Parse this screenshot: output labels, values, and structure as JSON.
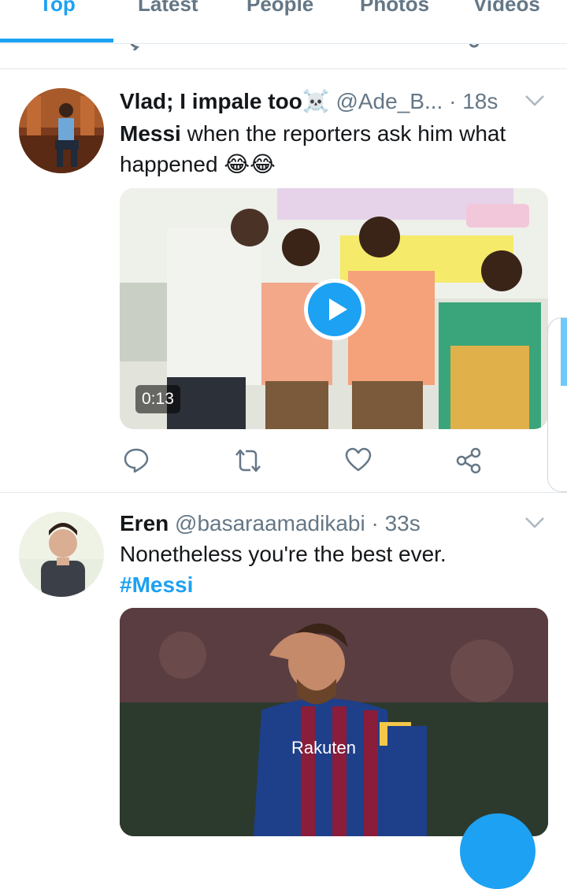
{
  "tabs": [
    {
      "label": "Top",
      "active": true
    },
    {
      "label": "Latest",
      "active": false
    },
    {
      "label": "People",
      "active": false
    },
    {
      "label": "Photos",
      "active": false
    },
    {
      "label": "Videos",
      "active": false
    }
  ],
  "tweets": [
    {
      "name": "Vlad; I impale too☠️",
      "handle": "@Ade_B...",
      "dot": "·",
      "time": "18s",
      "text_bold": "Messi",
      "text_rest": " when the reporters ask him what happened 😂😂",
      "media": {
        "type": "video",
        "duration": "0:13"
      }
    },
    {
      "name": "Eren",
      "handle": "@basaraamadikabi",
      "dot": "·",
      "time": "33s",
      "text": "Nonetheless you're the best ever.",
      "hashtag": "#Messi",
      "media": {
        "type": "photo",
        "jersey_text": "Rakuten"
      }
    }
  ],
  "icons": [
    "reply-icon",
    "retweet-icon",
    "like-icon",
    "share-icon",
    "chevron-down-icon",
    "play-icon"
  ],
  "colors": {
    "accent": "#1da1f2",
    "muted": "#657786",
    "divider": "#e1e8ed"
  }
}
